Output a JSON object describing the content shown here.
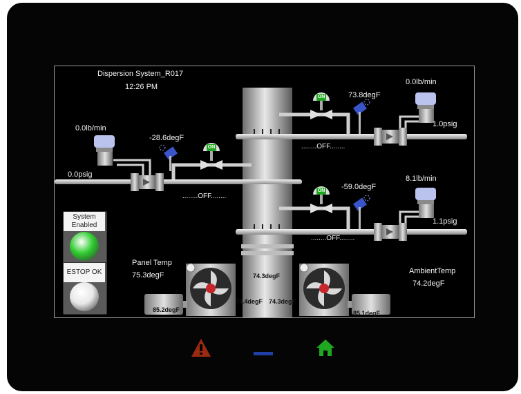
{
  "title": "Dispersion System_R017",
  "clock": "12:26 PM",
  "upper_left": {
    "flow": "0.0lb/min",
    "pressure": "0.0psig",
    "temp": "-28.6degF",
    "valve": "ON",
    "status": "........OFF........"
  },
  "upper_right": {
    "flow": "0.0lb/min",
    "pressure": "1.0psig",
    "temp": "73.8degF",
    "valve": "ON",
    "status": "........OFF........"
  },
  "lower_right": {
    "flow": "8.1lb/min",
    "pressure": "1.1psig",
    "temp": "-59.0degF",
    "valve": "ON",
    "status": "........OFF........"
  },
  "panel_temp": {
    "label": "Panel Temp",
    "value": "75.3degF"
  },
  "ambient_temp": {
    "label": "AmbientTemp",
    "value": "74.2degF"
  },
  "column_temps": {
    "top": "74.3degF",
    "left": "74.4degF",
    "right": "74.3degF"
  },
  "motor_temps": {
    "left": "85.2degF",
    "right": "85.1degF"
  },
  "system_indicator": {
    "label": "System Enabled",
    "state_color": "#2ecc2e"
  },
  "estop_indicator": {
    "label": "ESTOP OK",
    "state_color": "#e8e8e8"
  },
  "nav": {
    "alarm_icon": "warning-icon",
    "minimize_icon": "minimize-icon",
    "home_icon": "home-icon",
    "alarm_color": "#9b2a12",
    "minimize_color": "#1f3fa6",
    "home_color": "#1fa81f"
  }
}
